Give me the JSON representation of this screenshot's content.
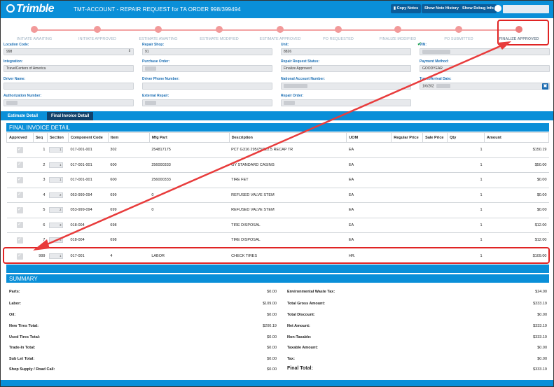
{
  "header": {
    "logo": "Trimble",
    "title": "TMT-ACCOUNT - REPAIR REQUEST for TA ORDER 998/399494",
    "copy_notes": "Copy Notes",
    "show_note_history": "Show Note History",
    "show_debug_info": "Show Debug Info"
  },
  "steps": [
    "INITIATE AWAITING",
    "INITIATE APPROVED",
    "ESTIMATE AWAITING",
    "ESTIMATE MODIFIED",
    "ESTIMATE APPROVED",
    "PO REQUESTED",
    "FINALIZE MODIFIED",
    "PO SUBMITTED",
    "FINALIZE APPROVED"
  ],
  "form": {
    "location_code": {
      "label": "Location Code:",
      "value": "998"
    },
    "repair_shop": {
      "label": "Repair Shop:",
      "value": "91"
    },
    "unit": {
      "label": "Unit:",
      "value": "8826"
    },
    "vin": {
      "label": "VIN:",
      "value": ""
    },
    "integration": {
      "label": "Integration:",
      "value": "TravelCenters of America"
    },
    "purchase_order": {
      "label": "Purchase Order:",
      "value": ""
    },
    "repair_request_status": {
      "label": "Repair Request Status:",
      "value": "Finalize Approved"
    },
    "payment_method": {
      "label": "Payment Method:",
      "value": "GOODYEAR"
    },
    "driver_name": {
      "label": "Driver Name:",
      "value": ""
    },
    "driver_phone": {
      "label": "Driver Phone Number:",
      "value": ""
    },
    "national_account": {
      "label": "National Account Number:",
      "value": ""
    },
    "travel_date": {
      "label": "Travel/Arrival Date:",
      "value": "1/6/202"
    },
    "authorization_number": {
      "label": "Authorization Number:",
      "value": ""
    },
    "external_repair": {
      "label": "External Repair:",
      "value": ""
    },
    "repair_order": {
      "label": "Repair Order:",
      "value": ""
    }
  },
  "tabs": [
    "Estimate Detail",
    "Final Invoice Detail"
  ],
  "invoice": {
    "title": "FINAL INVOICE DETAIL",
    "columns": [
      "Approved",
      "Seq",
      "Section",
      "Component Code",
      "Item",
      "Mfg Part",
      "Description",
      "UOM",
      "Regular Price",
      "Sale Price",
      "Qty",
      "Amount"
    ],
    "rows": [
      {
        "seq": "1",
        "section": "1",
        "component": "017-001-001",
        "item": "302",
        "mfg": "254817175",
        "desc": "PCT G316 295/75R22.5 RECAP TR",
        "uom": "EA",
        "qty": "1",
        "amount": "$150.19"
      },
      {
        "seq": "2",
        "section": "1",
        "component": "017-001-001",
        "item": "600",
        "mfg": "256000333",
        "desc": "GY STANDARD CASING",
        "uom": "EA",
        "qty": "1",
        "amount": "$50.00"
      },
      {
        "seq": "3",
        "section": "1",
        "component": "017-001-001",
        "item": "600",
        "mfg": "256000333",
        "desc": "TIRE FET",
        "uom": "EA",
        "qty": "1",
        "amount": "$0.00"
      },
      {
        "seq": "4",
        "section": "2",
        "component": "053-999-094",
        "item": "699",
        "mfg": "0",
        "desc": "REFUSED VALVE STEM",
        "uom": "EA",
        "qty": "1",
        "amount": "$0.00"
      },
      {
        "seq": "5",
        "section": "2",
        "component": "053-999-094",
        "item": "699",
        "mfg": "0",
        "desc": "REFUSED VALVE STEM",
        "uom": "EA",
        "qty": "1",
        "amount": "$0.00"
      },
      {
        "seq": "6",
        "section": "3",
        "component": "018-004",
        "item": "698",
        "mfg": "",
        "desc": "TIRE DISPOSAL",
        "uom": "EA",
        "qty": "1",
        "amount": "$12.00"
      },
      {
        "seq": "7",
        "section": "3",
        "component": "018-004",
        "item": "698",
        "mfg": "",
        "desc": "TIRE DISPOSAL",
        "uom": "EA",
        "qty": "1",
        "amount": "$12.00"
      },
      {
        "seq": "999",
        "section": "1",
        "component": "017-001",
        "item": "4",
        "mfg": "LABOR",
        "desc": "CHECK TIRES",
        "uom": "HR.",
        "qty": "1",
        "amount": "$109.00"
      }
    ]
  },
  "summary": {
    "title": "SUMMARY",
    "left": [
      {
        "label": "Parts:",
        "value": "$0.00"
      },
      {
        "label": "Labor:",
        "value": "$109.00"
      },
      {
        "label": "Oil:",
        "value": "$0.00"
      },
      {
        "label": "New Tires Total:",
        "value": "$200.19"
      },
      {
        "label": "Used Tires Total:",
        "value": "$0.00"
      },
      {
        "label": "Trade-In Total:",
        "value": "$0.00"
      },
      {
        "label": "Sub Let Total:",
        "value": "$0.00"
      },
      {
        "label": "Shop Supply / Road Call:",
        "value": "$0.00"
      }
    ],
    "right": [
      {
        "label": "Environmental Waste Tax:",
        "value": "$24.00"
      },
      {
        "label": "Total Gross Amount:",
        "value": "$333.19"
      },
      {
        "label": "Total Discount:",
        "value": "$0.00"
      },
      {
        "label": "Net Amount:",
        "value": "$333.19"
      },
      {
        "label": "Non-Taxable:",
        "value": "$333.19"
      },
      {
        "label": "Taxable Amount:",
        "value": "$0.00"
      },
      {
        "label": "Tax:",
        "value": "$0.00"
      },
      {
        "label": "Final Total:",
        "value": "$333.19"
      }
    ]
  },
  "colors": {
    "brand_blue": "#0a8fd8",
    "annotation_red": "#e02424",
    "step_dot": "#f29a9a"
  }
}
